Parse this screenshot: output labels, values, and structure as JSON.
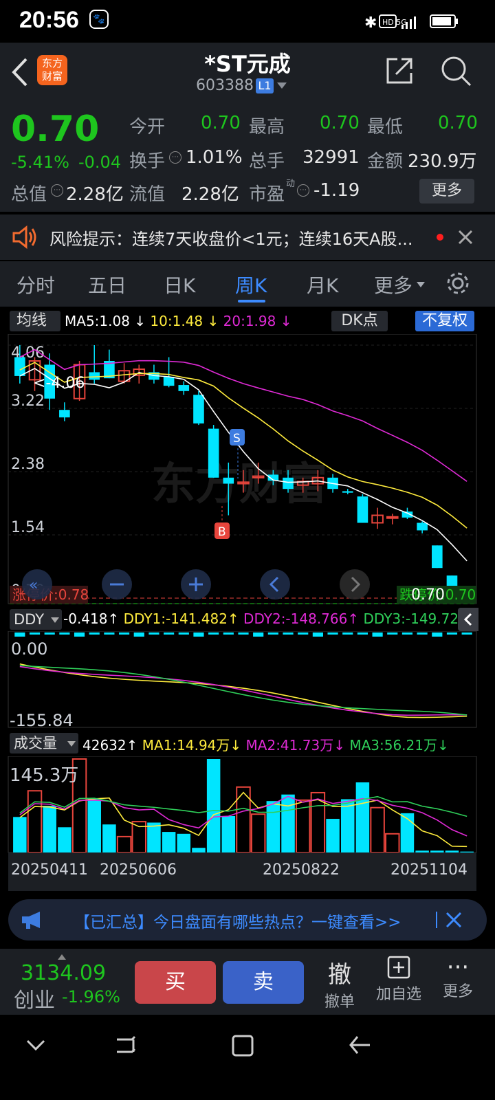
{
  "status": {
    "time": "20:56",
    "indicators": "HD 5G"
  },
  "header": {
    "logo": "东方\n财富",
    "logo_line1": "东方",
    "logo_line2": "财富",
    "title": "*ST元成",
    "code": "603388",
    "level": "L1"
  },
  "quote": {
    "price": "0.70",
    "change_pct": "-5.41%",
    "change": "-0.04",
    "open_label": "今开",
    "open": "0.70",
    "high_label": "最高",
    "high": "0.70",
    "low_label": "最低",
    "low": "0.70",
    "turnover_label": "换手",
    "turnover": "1.01%",
    "volume_label": "总手",
    "volume": "32991",
    "amount_label": "金额",
    "amount": "230.9万",
    "mcap_label": "总值",
    "mcap": "2.28亿",
    "float_label": "流值",
    "float": "2.28亿",
    "pe_label": "市盈",
    "pe_sup": "动",
    "pe": "-1.19",
    "more": "更多"
  },
  "risk": {
    "text": "风险提示：连续7天收盘价<1元；连续16天A股..."
  },
  "tabs": [
    "分时",
    "五日",
    "日K",
    "周K",
    "月K",
    "更多"
  ],
  "active_tab": "周K",
  "ma_bar": {
    "label": "均线",
    "ma5": "MA5:1.08",
    "ma10": "10:1.48",
    "ma20": "20:1.98",
    "dk": "DK点",
    "adj": "不复权"
  },
  "price_chart": {
    "yticks": [
      "4.06",
      "3.22",
      "2.38",
      "1.54",
      "0.70"
    ],
    "max_label": "<-4.06",
    "limit_up": "涨停价:0.78",
    "limit_down": "跌停价:0.70",
    "last": "0.70",
    "s_marker": "S",
    "b_marker": "B"
  },
  "ddy_bar": {
    "label": "DDY",
    "ddy": "-0.418",
    "ddy1": "DDY1:-141.482",
    "ddy2": "DDY2:-148.766",
    "ddy3": "DDY3:-149.725"
  },
  "ddy_chart": {
    "yticks": [
      "0.00",
      "-155.84"
    ]
  },
  "vol_bar": {
    "label": "成交量",
    "vol": "42632",
    "ma1": "MA1:14.94万",
    "ma2": "MA2:41.73万",
    "ma3": "MA3:56.21万"
  },
  "vol_chart": {
    "ytick": "145.3万"
  },
  "dates": [
    "20250411",
    "20250606",
    "20250822",
    "20251104"
  ],
  "ad": {
    "text": "【已汇总】今日盘面有哪些热点？一键查看>>"
  },
  "bottom": {
    "index_value": "3134.09",
    "index_name": "创业",
    "index_change": "-1.96%",
    "buy": "买",
    "sell": "卖",
    "cancel_icon": "撤",
    "cancel": "撤单",
    "add": "加自选",
    "more": "更多"
  },
  "colors": {
    "up": "#e8453c",
    "down": "#1ec51e",
    "candle_down": "#00e5ff",
    "ma5": "#ffffff",
    "ma10": "#ffec3d",
    "ma20": "#e02ad6",
    "accent": "#3d8bff"
  },
  "chart_data": {
    "type": "candlestick",
    "weekly_candles_ohlc": [
      [
        3.9,
        4.06,
        3.55,
        3.65
      ],
      [
        3.6,
        3.9,
        3.45,
        3.85
      ],
      [
        3.8,
        3.95,
        3.2,
        3.35
      ],
      [
        3.2,
        3.3,
        3.05,
        3.1
      ],
      [
        3.35,
        3.85,
        3.32,
        3.8
      ],
      [
        3.7,
        4.06,
        3.55,
        3.6
      ],
      [
        3.85,
        4.0,
        3.62,
        3.62
      ],
      [
        3.58,
        3.82,
        3.55,
        3.72
      ],
      [
        3.66,
        3.8,
        3.55,
        3.74
      ],
      [
        3.7,
        3.8,
        3.55,
        3.6
      ],
      [
        3.64,
        3.9,
        3.5,
        3.52
      ],
      [
        3.53,
        3.58,
        3.4,
        3.45
      ],
      [
        3.4,
        3.45,
        3.0,
        3.02
      ],
      [
        2.95,
        3.0,
        2.3,
        2.3
      ],
      [
        2.3,
        2.5,
        1.8,
        2.22
      ],
      [
        2.22,
        2.4,
        2.1,
        2.24
      ],
      [
        2.3,
        2.5,
        2.22,
        2.32
      ],
      [
        2.34,
        2.4,
        2.2,
        2.26
      ],
      [
        2.3,
        2.4,
        2.1,
        2.15
      ],
      [
        2.2,
        2.3,
        2.1,
        2.25
      ],
      [
        2.22,
        2.4,
        2.12,
        2.3
      ],
      [
        2.3,
        2.35,
        2.1,
        2.15
      ],
      [
        2.12,
        2.15,
        2.08,
        2.1
      ],
      [
        2.05,
        2.08,
        1.7,
        1.7
      ],
      [
        1.7,
        1.9,
        1.62,
        1.8
      ],
      [
        1.78,
        1.82,
        1.68,
        1.78
      ],
      [
        1.85,
        1.9,
        1.75,
        1.77
      ],
      [
        1.7,
        1.72,
        1.56,
        1.6
      ],
      [
        1.4,
        1.4,
        1.1,
        1.1
      ],
      [
        1.0,
        1.0,
        0.8,
        0.8
      ],
      [
        0.76,
        0.76,
        0.7,
        0.7
      ]
    ],
    "ma5": "MA5:1.08",
    "ma10": "10:1.48",
    "ma20": "20:1.98",
    "y_range": [
      0.7,
      4.06
    ],
    "volume_max": "145.3万"
  }
}
